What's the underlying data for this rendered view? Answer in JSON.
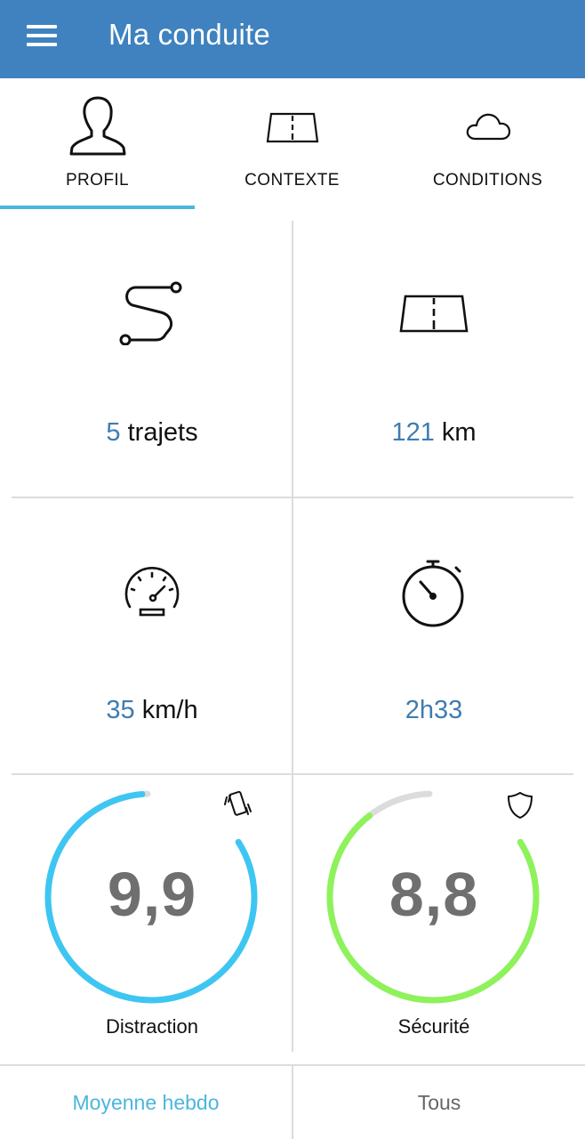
{
  "appbar": {
    "title": "Ma conduite",
    "menu_icon": "hamburger-menu-icon",
    "background_color": "#3f82bf"
  },
  "tabs": [
    {
      "label": "PROFIL",
      "icon": "person-silhouette-icon",
      "active": true
    },
    {
      "label": "CONTEXTE",
      "icon": "road-icon",
      "active": false
    },
    {
      "label": "CONDITIONS",
      "icon": "cloud-icon",
      "active": false
    }
  ],
  "stats": {
    "trips": {
      "value": "5",
      "unit": "trajets",
      "icon": "route-icon"
    },
    "distance": {
      "value": "121",
      "unit": "km",
      "icon": "road-icon"
    },
    "speed": {
      "value": "35",
      "unit": "km/h",
      "icon": "speedometer-icon"
    },
    "duration": {
      "value": "2h33",
      "icon": "stopwatch-icon"
    }
  },
  "scores": {
    "distraction": {
      "value": "9,9",
      "score": 9.9,
      "max": 10,
      "label": "Distraction",
      "color": "#3ec6f3",
      "icon": "phone-vibrate-icon"
    },
    "security": {
      "value": "8,8",
      "score": 8.8,
      "max": 10,
      "label": "Sécurité",
      "color": "#8ef25a",
      "icon": "shield-icon"
    }
  },
  "bottom_bar": {
    "weekly_average": {
      "label": "Moyenne hebdo",
      "active": true,
      "color": "#4bb6dc"
    },
    "all": {
      "label": "Tous",
      "active": false,
      "color": "#666666"
    }
  }
}
